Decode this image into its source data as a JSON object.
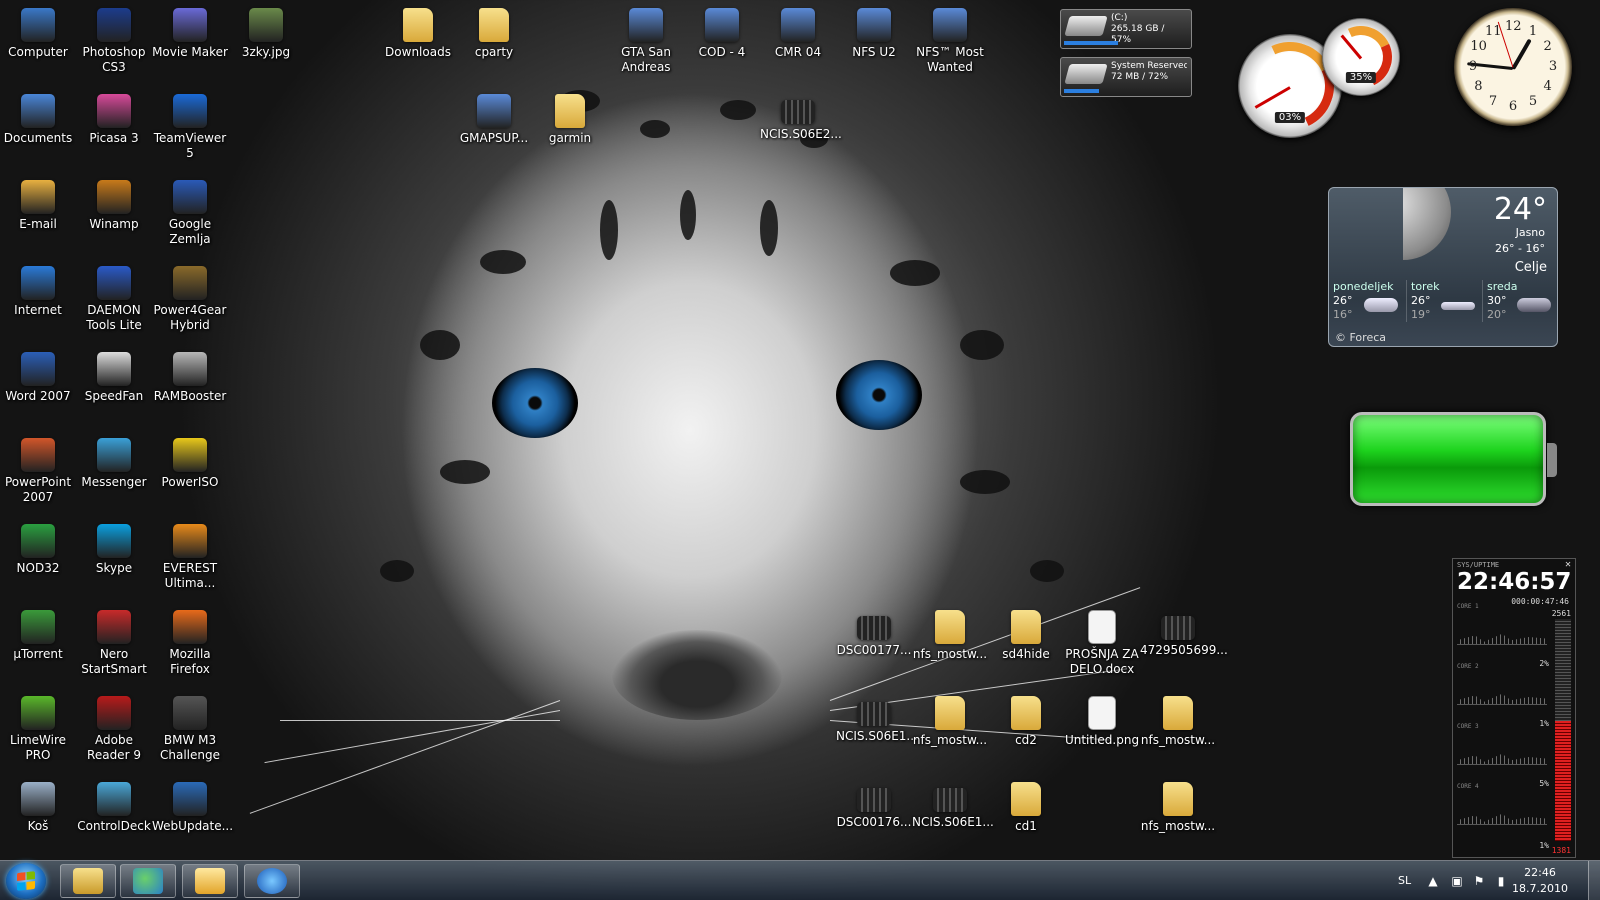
{
  "desktop": {
    "icons_col1": [
      "Computer",
      "Documents",
      "E-mail",
      "Internet",
      "Word 2007",
      "PowerPoint 2007",
      "NOD32",
      "µTorrent",
      "LimeWire PRO",
      "Koš"
    ],
    "icons_col2": [
      "Photoshop CS3",
      "Picasa 3",
      "Winamp",
      "DAEMON Tools Lite",
      "SpeedFan",
      "Messenger",
      "Skype",
      "Nero StartSmart",
      "Adobe Reader 9",
      "ControlDeck"
    ],
    "icons_col3": [
      "Movie Maker",
      "TeamViewer 5",
      "Google Zemlja",
      "Power4Gear Hybrid",
      "RAMBooster",
      "PowerISO",
      "EVEREST Ultima...",
      "Mozilla Firefox",
      "BMW M3 Challenge",
      "WebUpdate..."
    ],
    "icons_col4": [
      "3zky.jpg"
    ],
    "top_row": [
      "Downloads",
      "cparty",
      "GTA San Andreas",
      "COD - 4",
      "CMR 04",
      "NFS U2",
      "NFS™ Most Wanted"
    ],
    "second_row": [
      "GMAPSUP...",
      "garmin",
      "NCIS.S06E2..."
    ],
    "files_row1": [
      "DSC00177...",
      "nfs_mostw...",
      "sd4hide",
      "PROŠNJA ZA DELO.docx",
      "4729505699..."
    ],
    "files_row2": [
      "NCIS.S06E1...",
      "nfs_mostw...",
      "cd2",
      "Untitled.png",
      "nfs_mostw..."
    ],
    "files_row3": [
      "DSC00176...",
      "NCIS.S06E1...",
      "cd1",
      "nfs_mostw..."
    ],
    "icon_colors": {
      "Computer": "#3a78c8",
      "Documents": "#4a86d8",
      "E-mail": "#e8b040",
      "Internet": "#2a7ad8",
      "Word 2007": "#2b5fb8",
      "PowerPoint 2007": "#d2562a",
      "NOD32": "#2aa040",
      "µTorrent": "#3a9a3a",
      "LimeWire PRO": "#5ab82a",
      "Koš": "#9ab0c8",
      "Photoshop CS3": "#1c3c8c",
      "Picasa 3": "#d84a9a",
      "Winamp": "#c87a1a",
      "DAEMON Tools Lite": "#2a5ac8",
      "SpeedFan": "#dddddd",
      "Messenger": "#3aa0d8",
      "Skype": "#0aa0e0",
      "Nero StartSmart": "#c82a2a",
      "Adobe Reader 9": "#b81a1a",
      "ControlDeck": "#4aa8d8",
      "Movie Maker": "#6a6ad8",
      "TeamViewer 5": "#1a6ad8",
      "Google Zemlja": "#2a5ab8",
      "Power4Gear Hybrid": "#8a6a2a",
      "RAMBooster": "#b8b8b8",
      "PowerISO": "#e8c81a",
      "EVEREST Ultima...": "#e88a1a",
      "Mozilla Firefox": "#e86a1a",
      "BMW M3 Challenge": "#555555",
      "WebUpdate...": "#2a6ab8",
      "3zky.jpg": "#6a8a4a"
    }
  },
  "gadgets": {
    "drive_c": {
      "name": "(C:)",
      "info": "265.18 GB / 57%",
      "fill": 0.43
    },
    "drive_sys": {
      "name": "System Reserved",
      "info": "72 MB / 72%",
      "fill": 0.28
    },
    "cpu_meter": {
      "value": "03%"
    },
    "mem_meter": {
      "value": "35%"
    },
    "clock": {
      "numbers": [
        "12",
        "1",
        "2",
        "3",
        "4",
        "5",
        "6",
        "7",
        "8",
        "9",
        "10",
        "11"
      ]
    },
    "weather": {
      "temp": "24°",
      "condition": "Jasno",
      "range": "26° - 16°",
      "city": "Celje",
      "days": [
        {
          "name": "ponedeljek",
          "hi": "26°",
          "lo": "16°"
        },
        {
          "name": "torek",
          "hi": "26°",
          "lo": "19°"
        },
        {
          "name": "sreda",
          "hi": "30°",
          "lo": "20°"
        }
      ],
      "credit": "© Foreca"
    },
    "sysmon": {
      "title": "SYS/UPTIME",
      "time": "22:46:57",
      "uptime": "000:00:47:46",
      "cores": [
        {
          "label": "CORE 1",
          "value": ""
        },
        {
          "label": "CORE 2",
          "value": "2%"
        },
        {
          "label": "CORE 3",
          "value": "1%"
        },
        {
          "label": "CORE 4",
          "value": "5%"
        }
      ],
      "core_last": "1%",
      "mem_total": "2561",
      "mem_used": "1381",
      "mem_fraction": 0.54
    }
  },
  "taskbar": {
    "language": "SL",
    "time": "22:46",
    "date": "18.7.2010"
  }
}
